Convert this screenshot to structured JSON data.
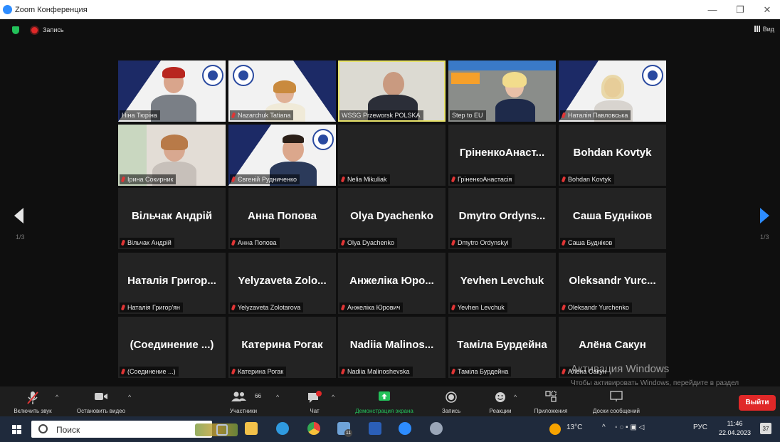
{
  "window": {
    "title": "Zoom Конференция",
    "minimize": "—",
    "restore": "❐",
    "close": "✕"
  },
  "topbar": {
    "recording_label": "Запись",
    "view_label": "Вид"
  },
  "pager": {
    "left_page": "1/3",
    "right_page": "1/3"
  },
  "tiles": [
    {
      "label": "Ніна Тюріна",
      "big": ""
    },
    {
      "label": "Nazarchuk Tatiana",
      "big": ""
    },
    {
      "label": "WSSG Przeworsk POLSKA",
      "big": ""
    },
    {
      "label": "Step to EU",
      "big": ""
    },
    {
      "label": "Наталія Павловська",
      "big": ""
    },
    {
      "label": "Ірина Сокирник",
      "big": ""
    },
    {
      "label": "Євгеній Рудниченко",
      "big": ""
    },
    {
      "label": "Nelia Mikuliak",
      "big": ""
    },
    {
      "label": "ГріненкоАнастасія",
      "big": "ГріненкоАнаст..."
    },
    {
      "label": "Bohdan Kovtyk",
      "big": "Bohdan Kovtyk"
    },
    {
      "label": "Вільчак Андрій",
      "big": "Вільчак Андрій"
    },
    {
      "label": "Анна Попова",
      "big": "Анна Попова"
    },
    {
      "label": "Olya Dyachenko",
      "big": "Olya Dyachenko"
    },
    {
      "label": "Dmytro Ordynskyi",
      "big": "Dmytro Ordyns..."
    },
    {
      "label": "Саша Будніков",
      "big": "Саша Будніков"
    },
    {
      "label": "Наталія Григор'ян",
      "big": "Наталія Григор..."
    },
    {
      "label": "Yelyzaveta Zolotarova",
      "big": "Yelyzaveta Zolo..."
    },
    {
      "label": "Анжеліка Юрович",
      "big": "Анжеліка Юро..."
    },
    {
      "label": "Yevhen Levchuk",
      "big": "Yevhen Levchuk"
    },
    {
      "label": "Oleksandr Yurchenko",
      "big": "Oleksandr Yurc..."
    },
    {
      "label": "(Соединение ...)",
      "big": "(Соединение ...)"
    },
    {
      "label": "Катерина Рогак",
      "big": "Катерина Рогак"
    },
    {
      "label": "Nadiia Malinoshevska",
      "big": "Nadiia Malinos..."
    },
    {
      "label": "Таміла Бурдейна",
      "big": "Таміла Бурдейна"
    },
    {
      "label": "Алёна Сакун",
      "big": "Алёна Сакун"
    }
  ],
  "watermark": {
    "line1": "Активация Windows",
    "line2": "Чтобы активировать Windows, перейдите в раздел \"Параметры\"."
  },
  "toolbar": {
    "unmute": "Включить звук",
    "stop_video": "Остановить видео",
    "participants": "Участники",
    "participants_count": "66",
    "chat": "Чат",
    "share": "Демонстрация экрана",
    "record": "Запись",
    "reactions": "Реакции",
    "apps": "Приложения",
    "whiteboards": "Доски сообщений",
    "leave": "Выйти",
    "share_color": "#23c15a",
    "leave_color": "#e02828"
  },
  "taskbar": {
    "search_placeholder": "Поиск",
    "chat_badge": "11",
    "temperature": "13°C",
    "lang": "РУС",
    "time": "11:46",
    "date": "22.04.2023",
    "notification_count": "37"
  }
}
